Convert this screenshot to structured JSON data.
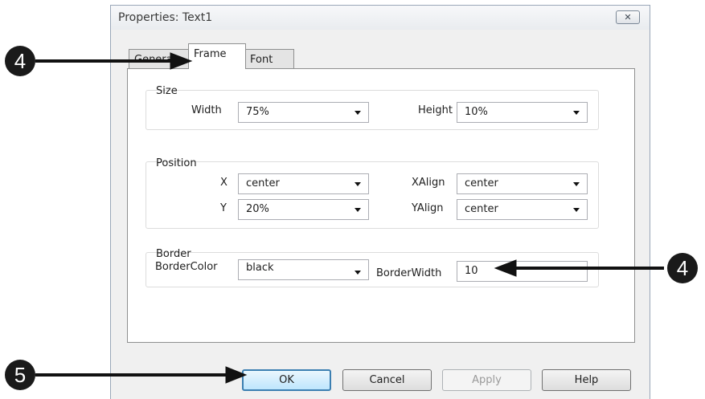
{
  "window": {
    "title": "Properties: Text1"
  },
  "tabs": [
    {
      "label": "General"
    },
    {
      "label": "Frame"
    },
    {
      "label": "Font"
    }
  ],
  "size_group": {
    "label": "Size",
    "width_label": "Width",
    "width_value": "75%",
    "height_label": "Height",
    "height_value": "10%"
  },
  "position_group": {
    "label": "Position",
    "x_label": "X",
    "x_value": "center",
    "xalign_label": "XAlign",
    "xalign_value": "center",
    "y_label": "Y",
    "y_value": "20%",
    "yalign_label": "YAlign",
    "yalign_value": "center"
  },
  "border_group": {
    "label": "Border",
    "color_label": "BorderColor",
    "color_value": "black",
    "width_label": "BorderWidth",
    "width_value": "10"
  },
  "buttons": {
    "ok": "OK",
    "cancel": "Cancel",
    "apply": "Apply",
    "help": "Help"
  },
  "callouts": {
    "tab_step": "4",
    "borderwidth_step": "4",
    "ok_step": "5"
  }
}
